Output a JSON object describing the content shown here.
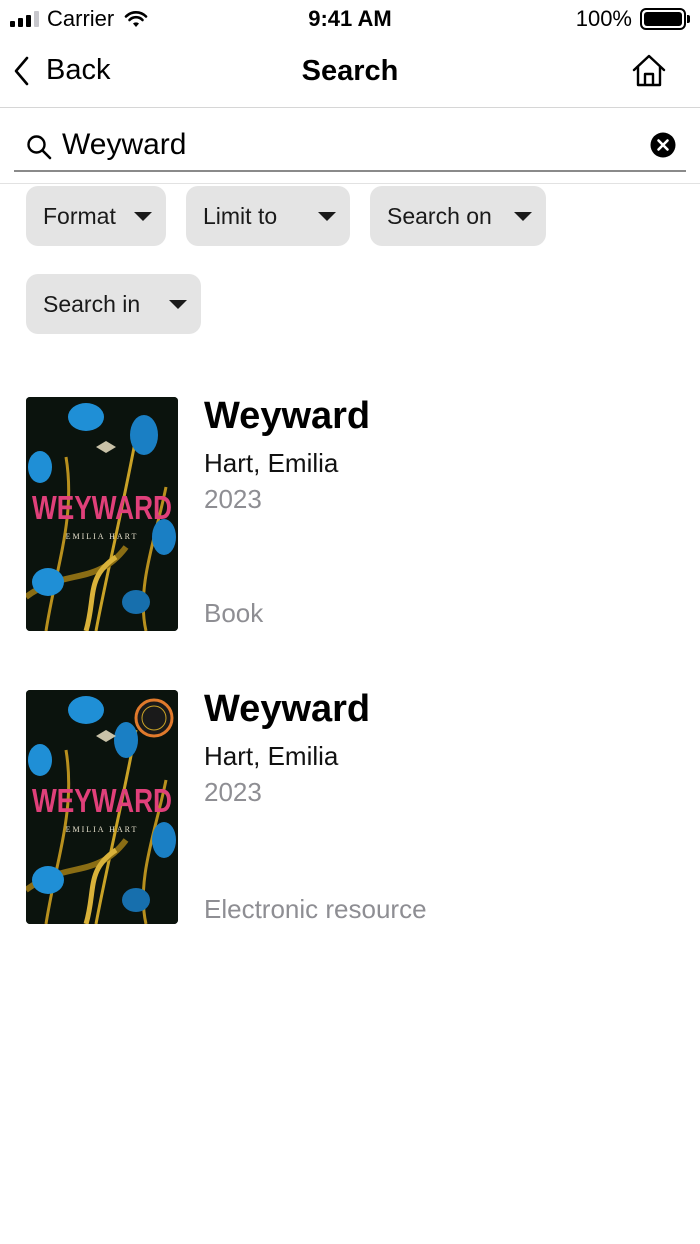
{
  "status_bar": {
    "carrier": "Carrier",
    "time": "9:41 AM",
    "battery": "100%"
  },
  "nav": {
    "back_label": "Back",
    "title": "Search"
  },
  "search": {
    "value": "Weyward"
  },
  "filters": [
    {
      "label": "Format"
    },
    {
      "label": "Limit to"
    },
    {
      "label": "Search on"
    },
    {
      "label": "Search in"
    }
  ],
  "results": [
    {
      "title": "Weyward",
      "author": "Hart, Emilia",
      "year": "2023",
      "format": "Book",
      "cover": {
        "title": "WEYWARD",
        "author": "EMILIA HART"
      }
    },
    {
      "title": "Weyward",
      "author": "Hart, Emilia",
      "year": "2023",
      "format": "Electronic resource",
      "cover": {
        "title": "WEYWARD",
        "author": "EMILIA HART"
      }
    }
  ],
  "colors": {
    "chip_bg": "#e4e4e4",
    "secondary_text": "#8e8e93",
    "cover_pink": "#e0407a",
    "cover_blue": "#1f8fd6",
    "cover_gold": "#c9a227"
  }
}
